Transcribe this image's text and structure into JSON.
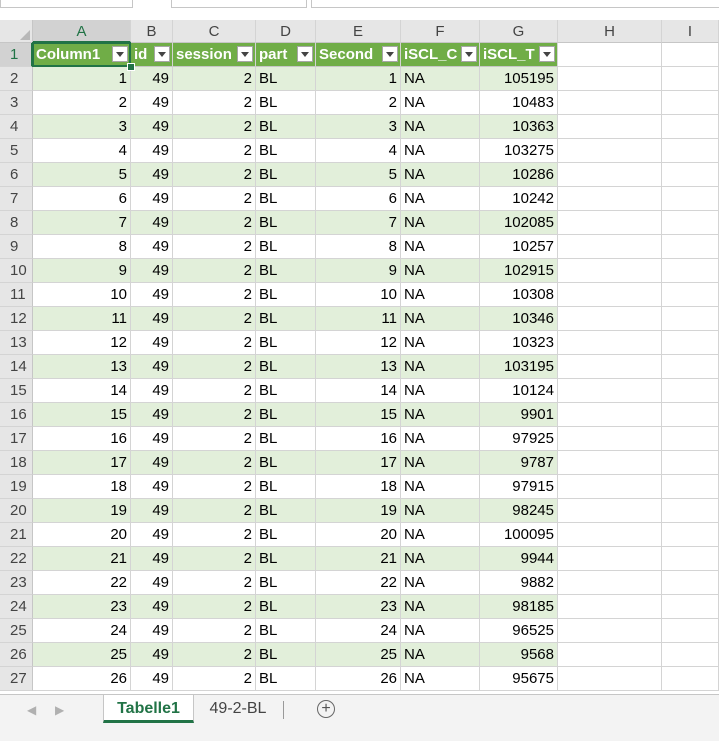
{
  "formula_bar": {
    "namebox": "",
    "formula": ""
  },
  "columns": [
    "A",
    "B",
    "C",
    "D",
    "E",
    "F",
    "G",
    "H",
    "I"
  ],
  "selected_column": "A",
  "selected_row": 1,
  "table": {
    "headers": [
      "Column1",
      "id",
      "session",
      "part",
      "Second",
      "iSCL_C",
      "iSCL_T"
    ],
    "rows": [
      [
        "1",
        "49",
        "2",
        "BL",
        "1",
        "NA",
        "105195"
      ],
      [
        "2",
        "49",
        "2",
        "BL",
        "2",
        "NA",
        "10483"
      ],
      [
        "3",
        "49",
        "2",
        "BL",
        "3",
        "NA",
        "10363"
      ],
      [
        "4",
        "49",
        "2",
        "BL",
        "4",
        "NA",
        "103275"
      ],
      [
        "5",
        "49",
        "2",
        "BL",
        "5",
        "NA",
        "10286"
      ],
      [
        "6",
        "49",
        "2",
        "BL",
        "6",
        "NA",
        "10242"
      ],
      [
        "7",
        "49",
        "2",
        "BL",
        "7",
        "NA",
        "102085"
      ],
      [
        "8",
        "49",
        "2",
        "BL",
        "8",
        "NA",
        "10257"
      ],
      [
        "9",
        "49",
        "2",
        "BL",
        "9",
        "NA",
        "102915"
      ],
      [
        "10",
        "49",
        "2",
        "BL",
        "10",
        "NA",
        "10308"
      ],
      [
        "11",
        "49",
        "2",
        "BL",
        "11",
        "NA",
        "10346"
      ],
      [
        "12",
        "49",
        "2",
        "BL",
        "12",
        "NA",
        "10323"
      ],
      [
        "13",
        "49",
        "2",
        "BL",
        "13",
        "NA",
        "103195"
      ],
      [
        "14",
        "49",
        "2",
        "BL",
        "14",
        "NA",
        "10124"
      ],
      [
        "15",
        "49",
        "2",
        "BL",
        "15",
        "NA",
        "9901"
      ],
      [
        "16",
        "49",
        "2",
        "BL",
        "16",
        "NA",
        "97925"
      ],
      [
        "17",
        "49",
        "2",
        "BL",
        "17",
        "NA",
        "9787"
      ],
      [
        "18",
        "49",
        "2",
        "BL",
        "18",
        "NA",
        "97915"
      ],
      [
        "19",
        "49",
        "2",
        "BL",
        "19",
        "NA",
        "98245"
      ],
      [
        "20",
        "49",
        "2",
        "BL",
        "20",
        "NA",
        "100095"
      ],
      [
        "21",
        "49",
        "2",
        "BL",
        "21",
        "NA",
        "9944"
      ],
      [
        "22",
        "49",
        "2",
        "BL",
        "22",
        "NA",
        "9882"
      ],
      [
        "23",
        "49",
        "2",
        "BL",
        "23",
        "NA",
        "98185"
      ],
      [
        "24",
        "49",
        "2",
        "BL",
        "24",
        "NA",
        "96525"
      ],
      [
        "25",
        "49",
        "2",
        "BL",
        "25",
        "NA",
        "9568"
      ],
      [
        "26",
        "49",
        "2",
        "BL",
        "26",
        "NA",
        "95675"
      ]
    ]
  },
  "row_numbers": [
    "1",
    "2",
    "3",
    "4",
    "5",
    "6",
    "7",
    "8",
    "9",
    "10",
    "11",
    "12",
    "13",
    "14",
    "15",
    "16",
    "17",
    "18",
    "19",
    "20",
    "21",
    "22",
    "23",
    "24",
    "25",
    "26",
    "27"
  ],
  "sheet_tabs": [
    {
      "label": "Tabelle1",
      "active": true
    },
    {
      "label": "49-2-BL",
      "active": false
    }
  ],
  "add_sheet_label": "+",
  "colors": {
    "header_fill": "#70ad47",
    "band_fill": "#e2efda",
    "accent": "#217346"
  }
}
